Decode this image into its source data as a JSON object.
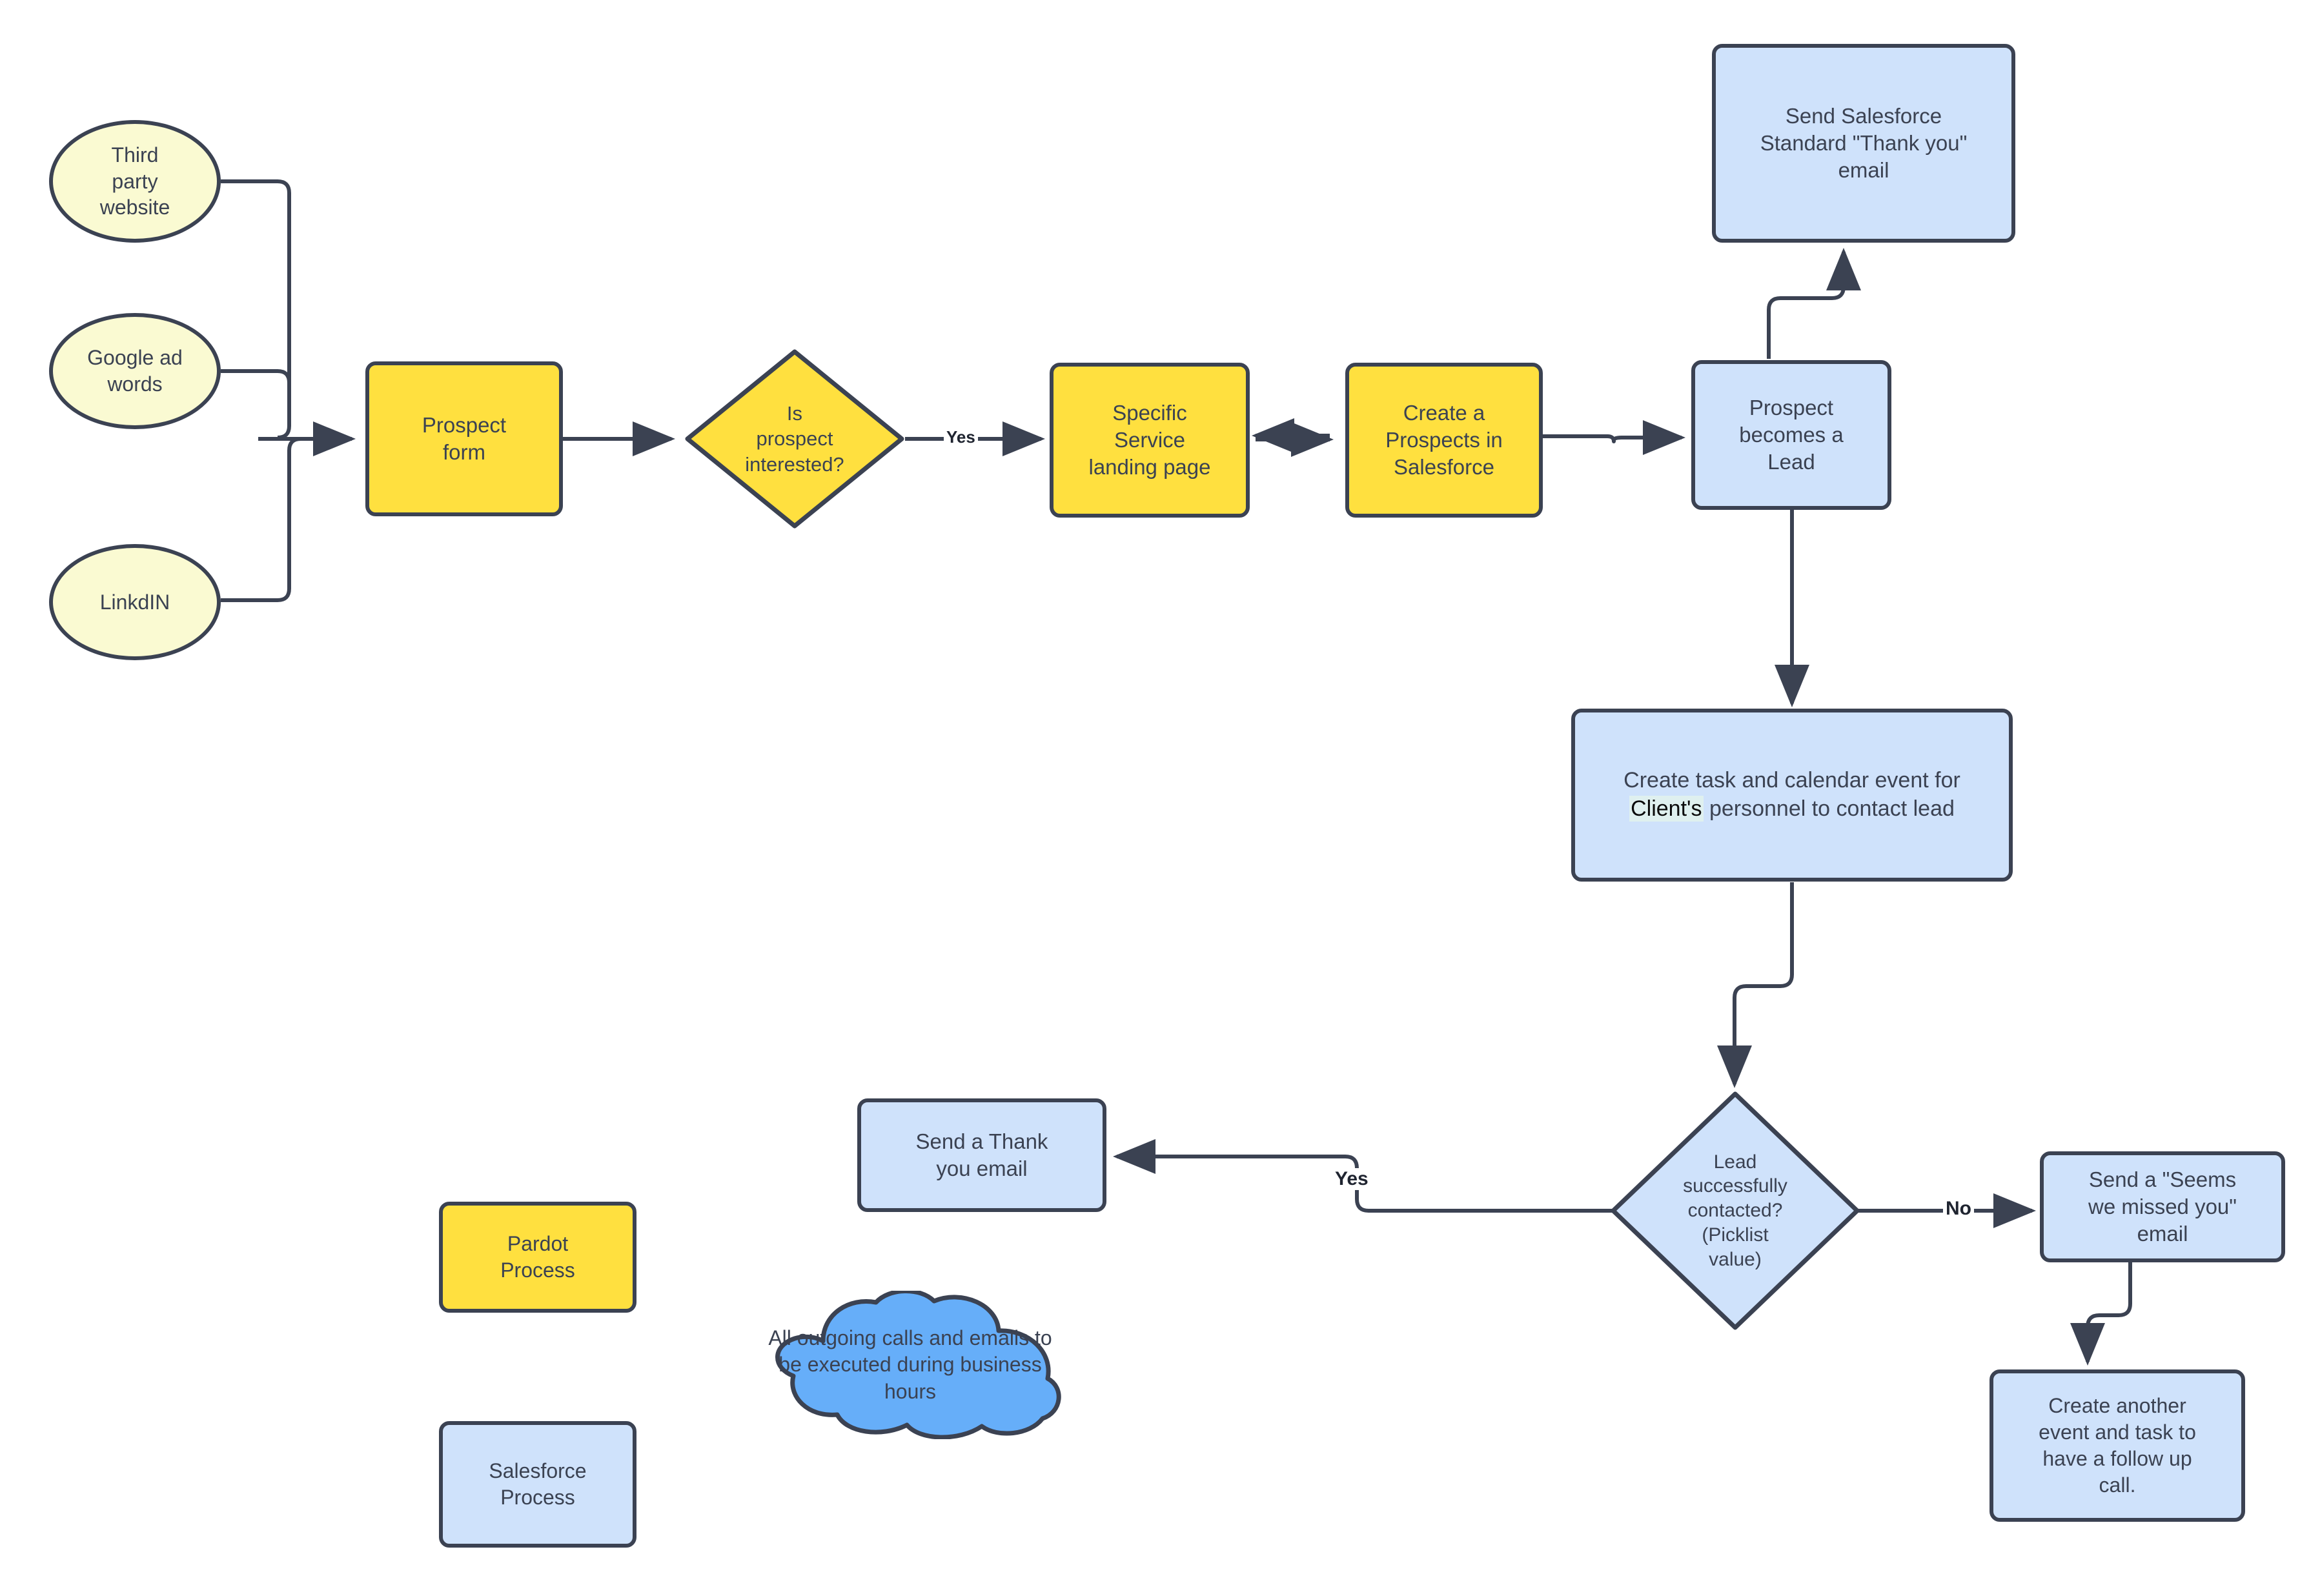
{
  "diagram": {
    "title": "Pardot / Salesforce lead generation process flow",
    "colors": {
      "pardot_fill": "#ffe03f",
      "salesforce_fill": "#cfe2fb",
      "terminator_fill": "#fafad2",
      "cloud_fill": "#66aef9",
      "stroke": "#3b4252",
      "text": "#3b4252",
      "highlight": "#dff0ef",
      "background": "#ffffff"
    }
  },
  "sources": [
    {
      "id": "third-party-website",
      "label": "Third\nparty\nwebsite"
    },
    {
      "id": "google-ad-words",
      "label": "Google ad\nwords"
    },
    {
      "id": "linkdin",
      "label": "LinkdIN"
    }
  ],
  "nodes": {
    "prospect_form": "Prospect\nform",
    "is_prospect_interested": "Is\nprospect\ninterested?",
    "specific_service_landing_page": "Specific\nService\nlanding page",
    "create_prospects_in_salesforce": "Create a\nProspects in\nSalesforce",
    "prospect_becomes_lead": "Prospect\nbecomes a\nLead",
    "send_salesforce_thank_you": "Send Salesforce\nStandard \"Thank you\"\nemail",
    "create_task_prefix": "Create task and calendar event for ",
    "create_task_highlight": "Client's",
    "create_task_suffix": " personnel to contact lead",
    "lead_successfully_contacted": "Lead\nsuccessfully\ncontacted?\n(Picklist\nvalue)",
    "send_thank_you_email": "Send a Thank\nyou email",
    "send_seems_we_missed_you": "Send a \"Seems\nwe missed you\"\nemail",
    "create_another_event_task": "Create another\nevent and task to\nhave a follow up\ncall."
  },
  "edge_labels": {
    "interested_yes": "Yes",
    "contacted_yes": "Yes",
    "contacted_no": "No"
  },
  "legend": {
    "pardot_process": "Pardot\nProcess",
    "salesforce_process": "Salesforce\nProcess"
  },
  "note": {
    "cloud_text": "All outgoing calls and emails to be executed during business hours"
  }
}
